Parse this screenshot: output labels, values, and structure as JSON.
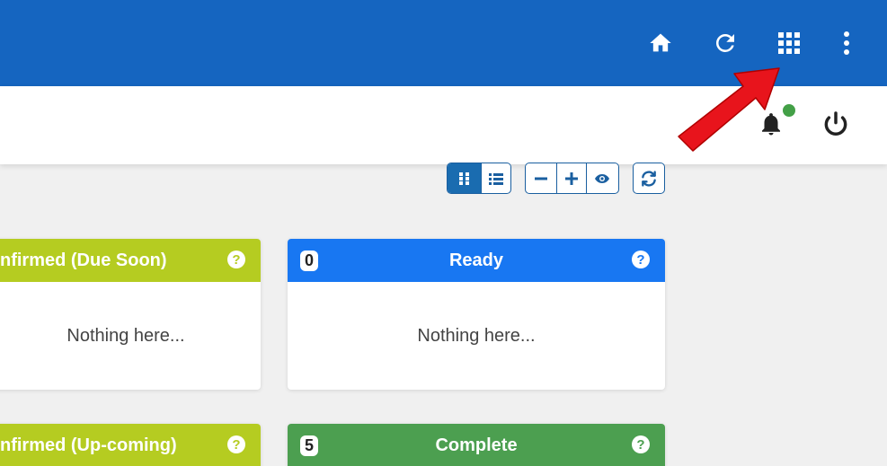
{
  "topbar": {
    "icons": [
      "home-icon",
      "refresh-icon",
      "apps-grid-icon",
      "more-vert-icon"
    ],
    "color": "#1565c0"
  },
  "subbar": {
    "icons": [
      "bell-icon",
      "power-icon"
    ],
    "notification_dot_color": "#43a047"
  },
  "toolbar": {
    "view_group": [
      "grid-view-icon",
      "list-view-icon"
    ],
    "zoom_group": [
      "minus-icon",
      "plus-icon",
      "eye-icon"
    ],
    "refresh": "sync-icon"
  },
  "cards": [
    {
      "title": "nfirmed (Due Soon)",
      "color": "#b5cc21",
      "count": "",
      "empty_text": "Nothing here..."
    },
    {
      "title": "Ready",
      "color": "#1877f2",
      "count": "0",
      "empty_text": "Nothing here..."
    },
    {
      "title": "nfirmed (Up-coming)",
      "color": "#b5cc21",
      "count": "",
      "empty_text": ""
    },
    {
      "title": "Complete",
      "color": "#4c9f50",
      "count": "5",
      "empty_text": ""
    }
  ],
  "help_symbol": "?",
  "annotation": {
    "type": "red-arrow",
    "color": "#e8141c"
  }
}
